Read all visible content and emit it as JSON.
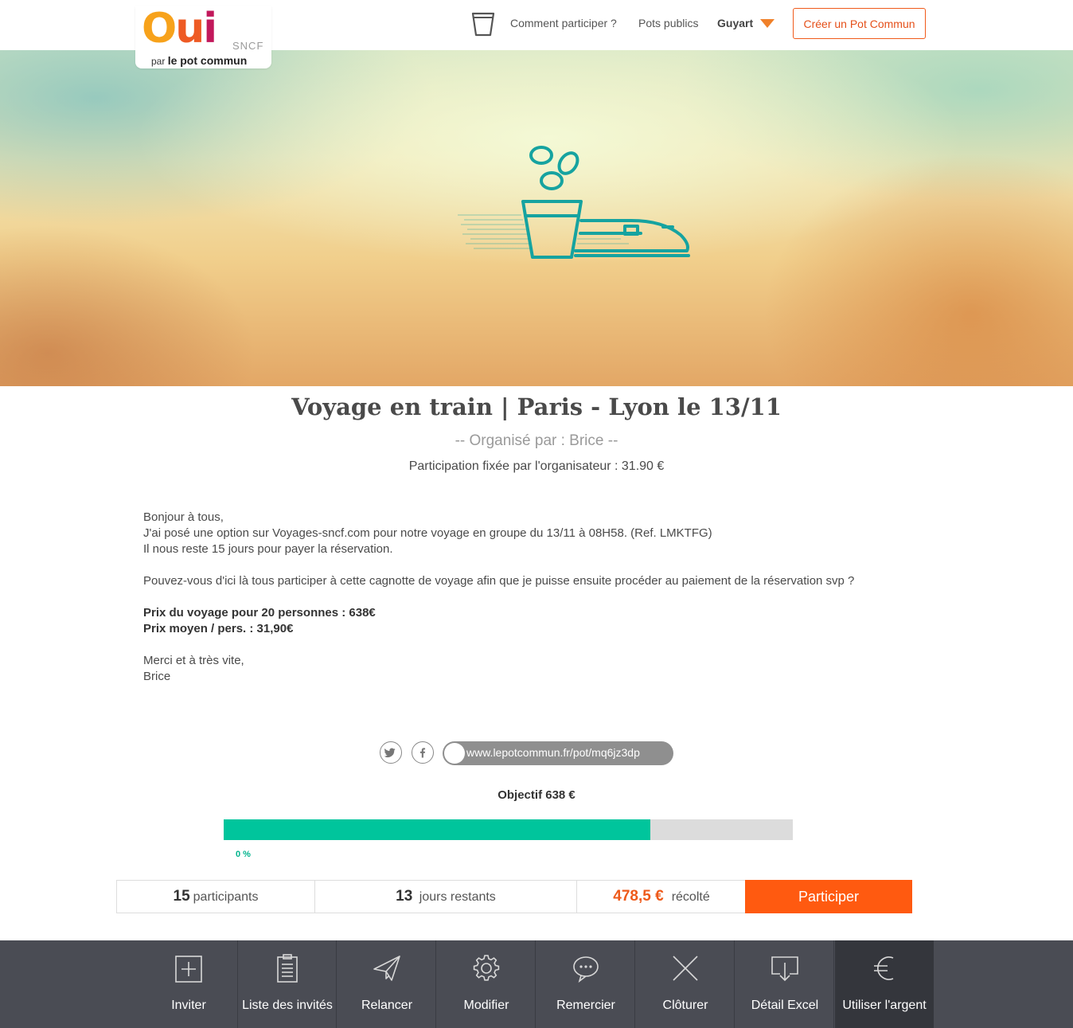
{
  "header": {
    "logo_oui_o": "O",
    "logo_oui_u": "u",
    "logo_oui_i": "i",
    "logo_sncf": "SNCF",
    "logo_par": "par",
    "logo_brand": "le pot commun",
    "nav": {
      "how_to": "Comment participer ?",
      "public_pots": "Pots publics",
      "user": "Guyart",
      "create_button": "Créer un Pot Commun"
    }
  },
  "pot": {
    "title": "Voyage en train | Paris - Lyon le 13/11",
    "organizer": "-- Organisé par : Brice --",
    "participation": "Participation fixée par l'organisateur : 31.90 €",
    "message": {
      "l1": "Bonjour à tous,",
      "l2": "J'ai posé une option sur Voyages-sncf.com pour notre voyage en groupe du 13/11 à 08H58. (Ref. LMKTFG)",
      "l3": "Il nous reste 15 jours pour payer la réservation.",
      "l4": "Pouvez-vous d'ici là tous participer à cette cagnotte de voyage afin que je puisse ensuite procéder au paiement de la réservation svp ?",
      "l5": "Prix du voyage pour 20 personnes : 638€",
      "l6": "Prix moyen / pers. : 31,90€",
      "l7": "Merci et à très vite,",
      "l8": "Brice"
    }
  },
  "share": {
    "twitter_icon": "twitter-icon",
    "facebook_icon": "facebook-icon",
    "url": "www.lepotcommun.fr/pot/mq6jz3dp"
  },
  "progress": {
    "objective": "Objectif 638 €",
    "fill_fraction": 0.75,
    "fill_color": "#00c59c",
    "percent_label": "0 %"
  },
  "stats": {
    "participants_num": "15",
    "participants_label": "participants",
    "days_num": "13",
    "days_label": "jours restants",
    "collected_num": "478,5 €",
    "collected_label": "récolté",
    "participate_button": "Participer",
    "accent_color": "#ff5a10"
  },
  "toolbar": {
    "invite": "Inviter",
    "guest_list": "Liste des invités",
    "remind": "Relancer",
    "edit": "Modifier",
    "thank": "Remercier",
    "close": "Clôturer",
    "excel": "Détail Excel",
    "use_money": "Utiliser l'argent"
  }
}
